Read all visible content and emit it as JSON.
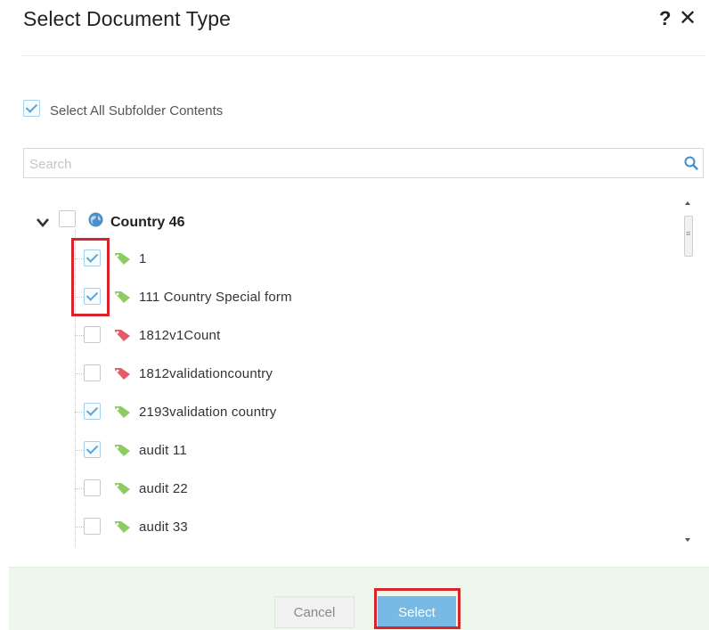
{
  "dialog": {
    "title": "Select Document Type",
    "help_glyph": "?",
    "close_glyph": "✕"
  },
  "select_all": {
    "label": "Select All Subfolder Contents",
    "checked": true
  },
  "search": {
    "placeholder": "Search",
    "value": ""
  },
  "tree": {
    "root": {
      "label": "Country 46",
      "checked": false,
      "expanded": true,
      "icon": "globe-icon"
    },
    "items": [
      {
        "label": "1",
        "checked": true,
        "tag_color": "#8ccc63"
      },
      {
        "label": "111 Country Special form",
        "checked": true,
        "tag_color": "#8ccc63"
      },
      {
        "label": "1812v1Count",
        "checked": false,
        "tag_color": "#e35a68"
      },
      {
        "label": "1812validationcountry",
        "checked": false,
        "tag_color": "#e35a68"
      },
      {
        "label": "2193validation country",
        "checked": true,
        "tag_color": "#8ccc63"
      },
      {
        "label": "audit 11",
        "checked": true,
        "tag_color": "#8ccc63"
      },
      {
        "label": "audit 22",
        "checked": false,
        "tag_color": "#8ccc63"
      },
      {
        "label": "audit 33",
        "checked": false,
        "tag_color": "#8ccc63"
      }
    ]
  },
  "footer": {
    "cancel_label": "Cancel",
    "select_label": "Select"
  },
  "colors": {
    "highlight": "#d9242b",
    "select_button": "#78b9e5",
    "footer_bg": "#eef7ec"
  }
}
